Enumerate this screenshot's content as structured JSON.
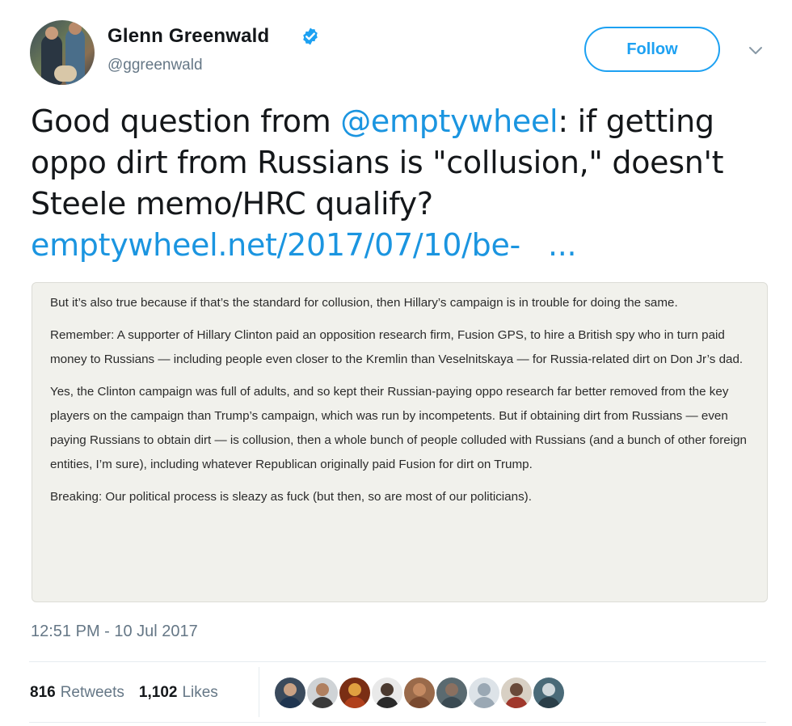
{
  "author": {
    "name": "Glenn Greenwald",
    "handle": "@ggreenwald",
    "verified": true
  },
  "follow_label": "Follow",
  "tweet": {
    "text_before": "Good question from ",
    "mention": "@emptywheel",
    "text_after": ": if getting oppo dirt from Russians is \"collusion,\" doesn't Steele memo/HRC qualify?",
    "link": "emptywheel.net/2017/07/10/be-",
    "ellipsis": "..."
  },
  "quote": {
    "paragraphs": [
      "But it’s also true because if that’s the standard for collusion, then Hillary’s campaign is in trouble for doing the same.",
      "Remember: A supporter of Hillary Clinton paid an opposition research firm, Fusion GPS, to hire a British spy who in turn paid money to Russians — including people even closer to the Kremlin than Veselnitskaya — for Russia-related dirt on Don Jr’s dad.",
      "Yes, the Clinton campaign was full of adults, and so kept their Russian-paying oppo research far better removed from the key players on the campaign than Trump’s campaign, which was run by incompetents. But if obtaining dirt from Russians — even paying Russians to obtain dirt — is collusion, then a whole bunch of people colluded with Russians (and a bunch of other foreign entities, I’m sure), including whatever Republican originally paid Fusion for dirt on Trump.",
      "Breaking: Our political process is sleazy as fuck (but then, so are most of our politicians)."
    ]
  },
  "timestamp": "12:51 PM - 10 Jul 2017",
  "stats": {
    "retweets_count": "816",
    "retweets_label": "Retweets",
    "likes_count": "1,102",
    "likes_label": "Likes"
  },
  "colors": {
    "accent": "#1da1f2",
    "link": "#1b95e0",
    "secondary_text": "#657786",
    "quote_bg": "#f1f1ec"
  },
  "liker_avatars": [
    {
      "bg": "#3a4a5c",
      "face": "#c9a184",
      "body": "#1f3550"
    },
    {
      "bg": "#cfd3d6",
      "face": "#b08060",
      "body": "#3a3a3a"
    },
    {
      "bg": "#7a2e14",
      "face": "#e0a040",
      "body": "#b0401c"
    },
    {
      "bg": "#e9e9e9",
      "face": "#4b3a30",
      "body": "#2a2a2a"
    },
    {
      "bg": "#9a6a4a",
      "face": "#c48a62",
      "body": "#7a4a30"
    },
    {
      "bg": "#5a6a70",
      "face": "#8a7060",
      "body": "#3a4a52"
    },
    {
      "bg": "#dde3e8",
      "face": "#9aa8b4",
      "body": "#9aa8b4"
    },
    {
      "bg": "#d8d0c4",
      "face": "#6a4a3a",
      "body": "#a0382c"
    },
    {
      "bg": "#4a6a78",
      "face": "#d0d8dc",
      "body": "#2a3e48"
    }
  ]
}
